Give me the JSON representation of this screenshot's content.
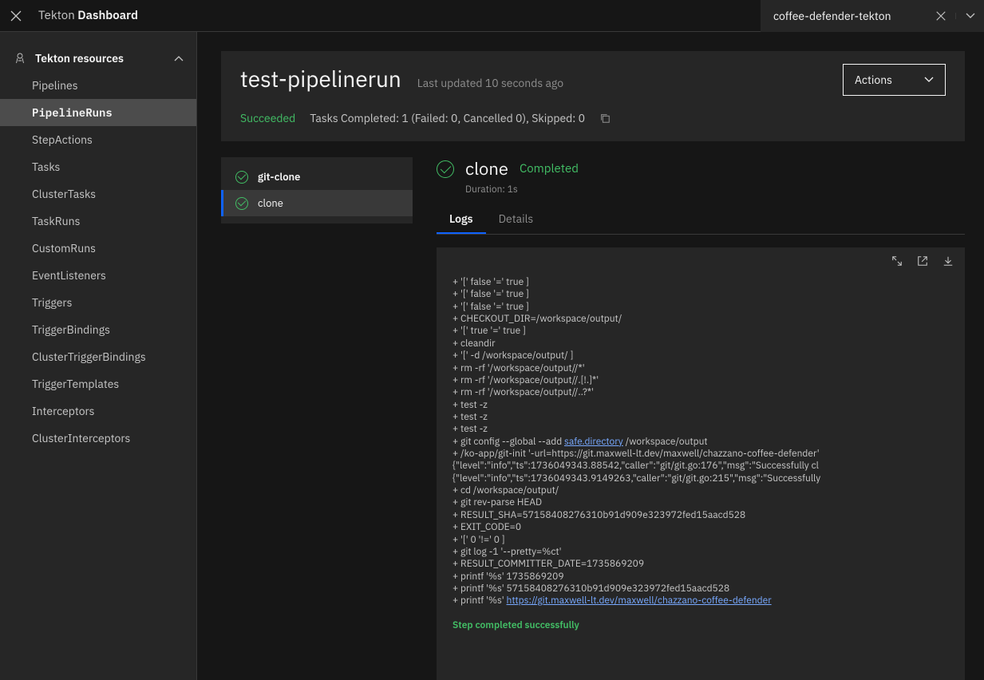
{
  "header": {
    "title_prefix": "Tekton ",
    "title_main": "Dashboard",
    "project": "coffee-defender-tekton"
  },
  "sidebar": {
    "logo_alt": "Tekton",
    "section_title": "Tekton resources",
    "items": [
      "Pipelines",
      "PipelineRuns",
      "StepActions",
      "Tasks",
      "ClusterTasks",
      "TaskRuns",
      "CustomRuns",
      "EventListeners",
      "Triggers",
      "TriggerBindings",
      "ClusterTriggerBindings",
      "TriggerTemplates",
      "Interceptors",
      "ClusterInterceptors"
    ],
    "active_index": 1
  },
  "run": {
    "name": "test-pipelinerun",
    "last_updated": "Last updated 10 seconds ago",
    "status": "Succeeded",
    "tasks_completed": "Tasks Completed: 1 (Failed: 0, Cancelled 0), Skipped: 0",
    "actions_label": "Actions"
  },
  "tasks": [
    {
      "name": "git-clone",
      "heading": true
    },
    {
      "name": "clone",
      "selected": true
    }
  ],
  "step": {
    "name": "clone",
    "status": "Completed",
    "duration": "Duration: 1s"
  },
  "tabs": [
    {
      "label": "Logs",
      "active": true
    },
    {
      "label": "Details",
      "active": false
    }
  ],
  "log_lines": [
    "+ '[' false '=' true ]",
    "+ '[' false '=' true ]",
    "+ '[' false '=' true ]",
    "+ CHECKOUT_DIR=/workspace/output/",
    "+ '[' true '=' true ]",
    "+ cleandir",
    "+ '[' -d /workspace/output/ ]",
    "+ rm -rf '/workspace/output//*'",
    "+ rm -rf '/workspace/output//.[!.]*'",
    "+ rm -rf '/workspace/output//..?*'",
    "+ test -z",
    "+ test -z",
    "+ test -z",
    {
      "pre": "+ git config --global --add ",
      "link": "safe.directory",
      "post": " /workspace/output"
    },
    "+ /ko-app/git-init '-url=https://git.maxwell-lt.dev/maxwell/chazzano-coffee-defender'",
    "{\"level\":\"info\",\"ts\":1736049343.88542,\"caller\":\"git/git.go:176\",\"msg\":\"Successfully cl",
    "{\"level\":\"info\",\"ts\":1736049343.9149263,\"caller\":\"git/git.go:215\",\"msg\":\"Successfully",
    "+ cd /workspace/output/",
    "+ git rev-parse HEAD",
    "+ RESULT_SHA=57158408276310b91d909e323972fed15aacd528",
    "+ EXIT_CODE=0",
    "+ '[' 0 '!=' 0 ]",
    "+ git log -1 '--pretty=%ct'",
    "+ RESULT_COMMITTER_DATE=1735869209",
    "+ printf '%s' 1735869209",
    "+ printf '%s' 57158408276310b91d909e323972fed15aacd528",
    {
      "pre": "+ printf '%s' ",
      "link": "https://git.maxwell-lt.dev/maxwell/chazzano-coffee-defender",
      "post": ""
    }
  ],
  "log_footer": "Step completed successfully"
}
